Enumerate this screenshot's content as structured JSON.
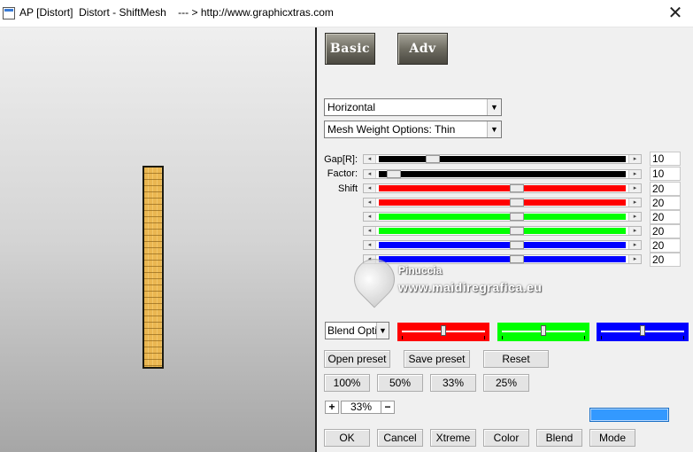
{
  "window": {
    "title": "AP [Distort]  Distort - ShiftMesh    --- > http://www.graphicxtras.com",
    "close_glyph": "✕"
  },
  "tabs": {
    "basic": "Basic",
    "adv": "Adv"
  },
  "dropdowns": {
    "direction": "Horizontal",
    "mesh_weight": "Mesh Weight Options: Thin"
  },
  "sliders": {
    "gap_label": "Gap[R]:",
    "factor_label": "Factor:",
    "shift_label": "Shift",
    "rows": [
      {
        "value": "10",
        "color": "#000000",
        "fraction": 0.22
      },
      {
        "value": "10",
        "color": "#000000",
        "fraction": 0.06
      },
      {
        "value": "20",
        "color": "#ff0000",
        "fraction": 0.56
      },
      {
        "value": "20",
        "color": "#ff0000",
        "fraction": 0.56
      },
      {
        "value": "20",
        "color": "#00ff00",
        "fraction": 0.56
      },
      {
        "value": "20",
        "color": "#00ff00",
        "fraction": 0.56
      },
      {
        "value": "20",
        "color": "#0000ff",
        "fraction": 0.56
      },
      {
        "value": "20",
        "color": "#0000ff",
        "fraction": 0.56
      }
    ]
  },
  "watermark": {
    "name": "Pinuccia",
    "url": "www.maidiregrafica.eu"
  },
  "blend": {
    "label": "Blend Optio",
    "swatches": [
      {
        "color": "#ff0000",
        "level": 0.5
      },
      {
        "color": "#00ff00",
        "level": 0.5
      },
      {
        "color": "#0000ff",
        "level": 0.5
      }
    ]
  },
  "buttons": {
    "open_preset": "Open preset",
    "save_preset": "Save preset",
    "reset": "Reset",
    "zoom_100": "100%",
    "zoom_50": "50%",
    "zoom_33": "33%",
    "zoom_25": "25%",
    "ok": "OK",
    "cancel": "Cancel",
    "xtreme": "Xtreme",
    "color": "Color",
    "blend": "Blend",
    "mode": "Mode"
  },
  "zoom": {
    "plus": "+",
    "value": "33%",
    "minus": "−"
  },
  "colors": {
    "accent_bar": "#3399ff",
    "preview_strip": "#eab650"
  }
}
